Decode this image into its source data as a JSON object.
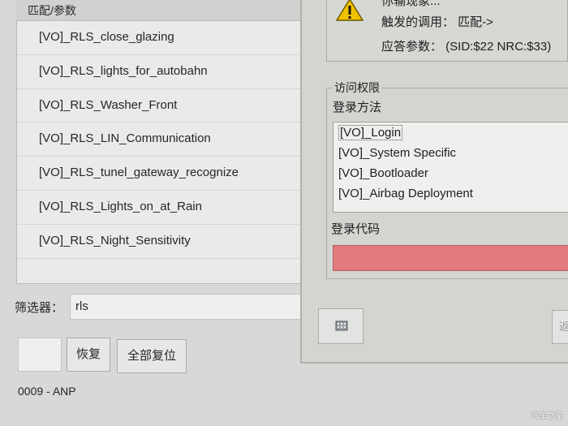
{
  "left_panel": {
    "header": "匹配/参数",
    "items": [
      "[VO]_RLS_close_glazing",
      "[VO]_RLS_lights_for_autobahn",
      "[VO]_RLS_Washer_Front",
      "[VO]_RLS_LIN_Communication",
      "[VO]_RLS_tunel_gateway_recognize",
      "[VO]_RLS_Lights_on_at_Rain",
      "[VO]_RLS_Night_Sensitivity"
    ],
    "filter_label": "筛选器：",
    "filter_value": "rls",
    "restore_label": "恢复",
    "reset_all_label": "全部复位",
    "status": "0009 - ANP"
  },
  "dialog": {
    "top_clip": "你输现象...",
    "trigger_call": "触发的调用： 匹配->",
    "response_params": "应答参数： (SID:$22 NRC:$33)",
    "group_title": "访问权限",
    "login_method_label": "登录方法",
    "login_methods": [
      "[VO]_Login",
      "[VO]_System Specific",
      "[VO]_Bootloader",
      "[VO]_Airbag Deployment"
    ],
    "login_code_label": "登录代码",
    "login_code_value": "",
    "partial_button": "返"
  },
  "watermark": "汽车之家",
  "colors": {
    "login_code_bg": "#e27b7d",
    "warning": "#f2c200"
  }
}
